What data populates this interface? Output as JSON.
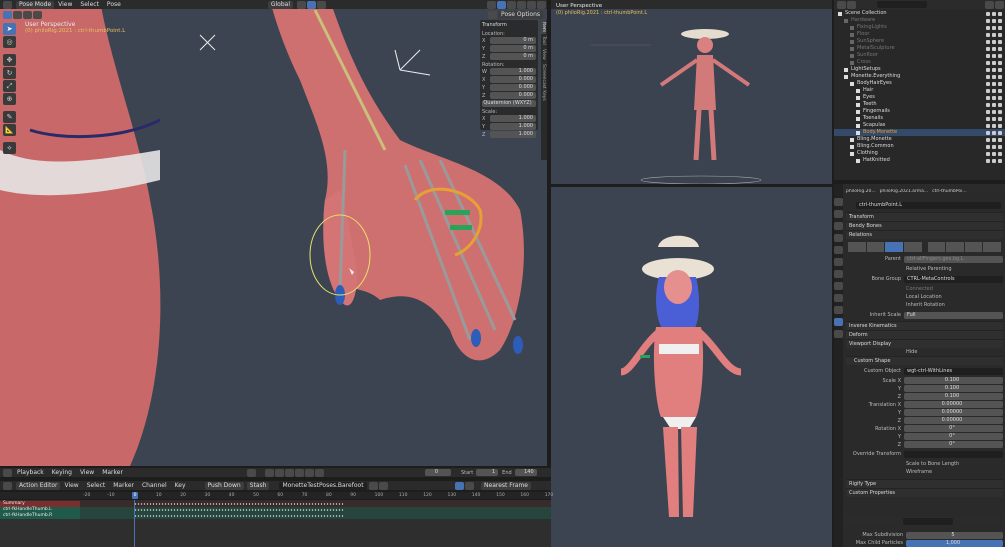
{
  "viewport_left": {
    "mode": "Pose Mode",
    "menus": [
      "View",
      "Select",
      "Pose"
    ],
    "transform_orientation": "Global",
    "title": "User Perspective",
    "subtitle": "(0) philoRig.2021 : ctrl-thumbPoint.L",
    "pose_options": "Pose Options"
  },
  "transform_panel": {
    "title": "Transform",
    "location_label": "Location:",
    "location": [
      [
        "X",
        "0 m"
      ],
      [
        "Y",
        "0 m"
      ],
      [
        "Z",
        "0 m"
      ]
    ],
    "rotation_label": "Rotation:",
    "rotation": [
      [
        "W",
        "1.000"
      ],
      [
        "X",
        "0.000"
      ],
      [
        "Y",
        "0.000"
      ],
      [
        "Z",
        "0.000"
      ]
    ],
    "rotation_mode": "Quaternion (WXYZ)",
    "scale_label": "Scale:",
    "scale": [
      [
        "X",
        "1.000"
      ],
      [
        "Y",
        "1.000"
      ],
      [
        "Z",
        "1.000"
      ]
    ]
  },
  "side_tabs": [
    "Item",
    "Tool",
    "View",
    "Screencast Keys"
  ],
  "viewport_right": {
    "title": "User Perspective",
    "subtitle": "(0) philoRig.2021 : ctrl-thumbPoint.L"
  },
  "outliner": {
    "items": [
      {
        "indent": 0,
        "label": "Scene Collection",
        "dim": false
      },
      {
        "indent": 1,
        "label": "Hardware",
        "dim": true
      },
      {
        "indent": 2,
        "label": "FixingLights",
        "dim": true
      },
      {
        "indent": 2,
        "label": "Floor",
        "dim": true
      },
      {
        "indent": 2,
        "label": "SunSphere",
        "dim": true
      },
      {
        "indent": 2,
        "label": "MetalSculpture",
        "dim": true
      },
      {
        "indent": 2,
        "label": "Sunfloor",
        "dim": true
      },
      {
        "indent": 2,
        "label": "Cross",
        "dim": true
      },
      {
        "indent": 1,
        "label": "LightSetups",
        "dim": false
      },
      {
        "indent": 1,
        "label": "Monette.Everything",
        "dim": false
      },
      {
        "indent": 2,
        "label": "BodyHairEyes",
        "dim": false
      },
      {
        "indent": 3,
        "label": "Hair",
        "dim": false
      },
      {
        "indent": 3,
        "label": "Eyes",
        "dim": false
      },
      {
        "indent": 3,
        "label": "Teeth",
        "dim": false
      },
      {
        "indent": 3,
        "label": "Fingernails",
        "dim": false
      },
      {
        "indent": 3,
        "label": "Toenails",
        "dim": false
      },
      {
        "indent": 3,
        "label": "Scapulas",
        "dim": false
      },
      {
        "indent": 3,
        "label": "Body.Monette",
        "dim": false,
        "selected": true
      },
      {
        "indent": 2,
        "label": "Bling.Monette",
        "dim": false
      },
      {
        "indent": 2,
        "label": "Bling.Common",
        "dim": false
      },
      {
        "indent": 2,
        "label": "Clothing",
        "dim": false
      },
      {
        "indent": 3,
        "label": "HatKnitted",
        "dim": false
      }
    ]
  },
  "properties": {
    "breadcrumb": [
      "philoRig.20...",
      "philoRig.2021.arma...",
      "ctrl-thumbPoi..."
    ],
    "bone_name": "ctrl-thumbPoint.L",
    "sections": {
      "transform": "Transform",
      "bendy_bones": "Bendy Bones",
      "relations": "Relations",
      "inverse_kinematics": "Inverse Kinematics",
      "deform": "Deform",
      "viewport_display": "Viewport Display",
      "custom_shape": "Custom Shape",
      "rigify_type": "Rigify Type",
      "custom_properties": "Custom Properties"
    },
    "relations": {
      "parent_label": "Parent",
      "parent_value": "ctrl-allFingers.ges.bg.L",
      "relative_parenting": "Relative Parenting",
      "bone_group_label": "Bone Group",
      "bone_group_value": "CTRL-MetaControls",
      "connected": "Connected",
      "local_location": "Local Location",
      "inherit_rotation": "Inherit Rotation",
      "inherit_scale_label": "Inherit Scale",
      "inherit_scale_value": "Full"
    },
    "viewport_display": {
      "hide": "Hide"
    },
    "custom_shape": {
      "object_label": "Custom Object",
      "object_value": "wgt-ctrl-WithLines",
      "scale_label": "Scale X",
      "scale": [
        "0.100",
        "0.100",
        "0.100"
      ],
      "translation_label": "Translation X",
      "translation": [
        "0.00000",
        "0.00000",
        "0.00000"
      ],
      "rotation_label": "Rotation X",
      "rotation": [
        "0°",
        "0°",
        "0°"
      ],
      "axis_y": "Y",
      "axis_z": "Z",
      "override_transform": "Override Transform",
      "scale_to_bone_length": "Scale to Bone Length",
      "wireframe": "Wireframe"
    },
    "footer": {
      "max_subdivision_label": "Max Subdivision",
      "max_subdivision_value": "5",
      "max_child_particles_label": "Max Child Particles",
      "max_child_particles_value": "1,000"
    }
  },
  "timeline": {
    "menus": [
      "Playback",
      "Keying",
      "View",
      "Marker"
    ],
    "current_frame": "0",
    "start_label": "Start",
    "start_value": "1",
    "end_label": "End",
    "end_value": "140"
  },
  "action_editor": {
    "mode": "Action Editor",
    "menus": [
      "View",
      "Select",
      "Marker",
      "Channel",
      "Key"
    ],
    "push_down": "Push Down",
    "stash": "Stash",
    "action_name": "MonetteTestPoses.Barefoot",
    "snap": "Nearest Frame",
    "frames": [
      "-20",
      "-10",
      "0",
      "10",
      "20",
      "30",
      "40",
      "50",
      "60",
      "70",
      "80",
      "90",
      "100",
      "110",
      "120",
      "130",
      "140",
      "150",
      "160",
      "170"
    ],
    "current_frame_marker": "0",
    "tracks": [
      {
        "label": "Summary",
        "color": "#7a2e2e"
      },
      {
        "label": "ctrl-fkHandleThumb.L",
        "color": "#1f5a4a"
      },
      {
        "label": "ctrl-fkHandleThumb.R",
        "color": "#1f5a4a"
      }
    ]
  },
  "colors": {
    "accent": "#4772b3",
    "header": "#2b2b2b",
    "viewport_bg": "#3d4450",
    "skin": "#c96b6b",
    "selected_row": "#334a6b",
    "orange": "#e7a033"
  }
}
